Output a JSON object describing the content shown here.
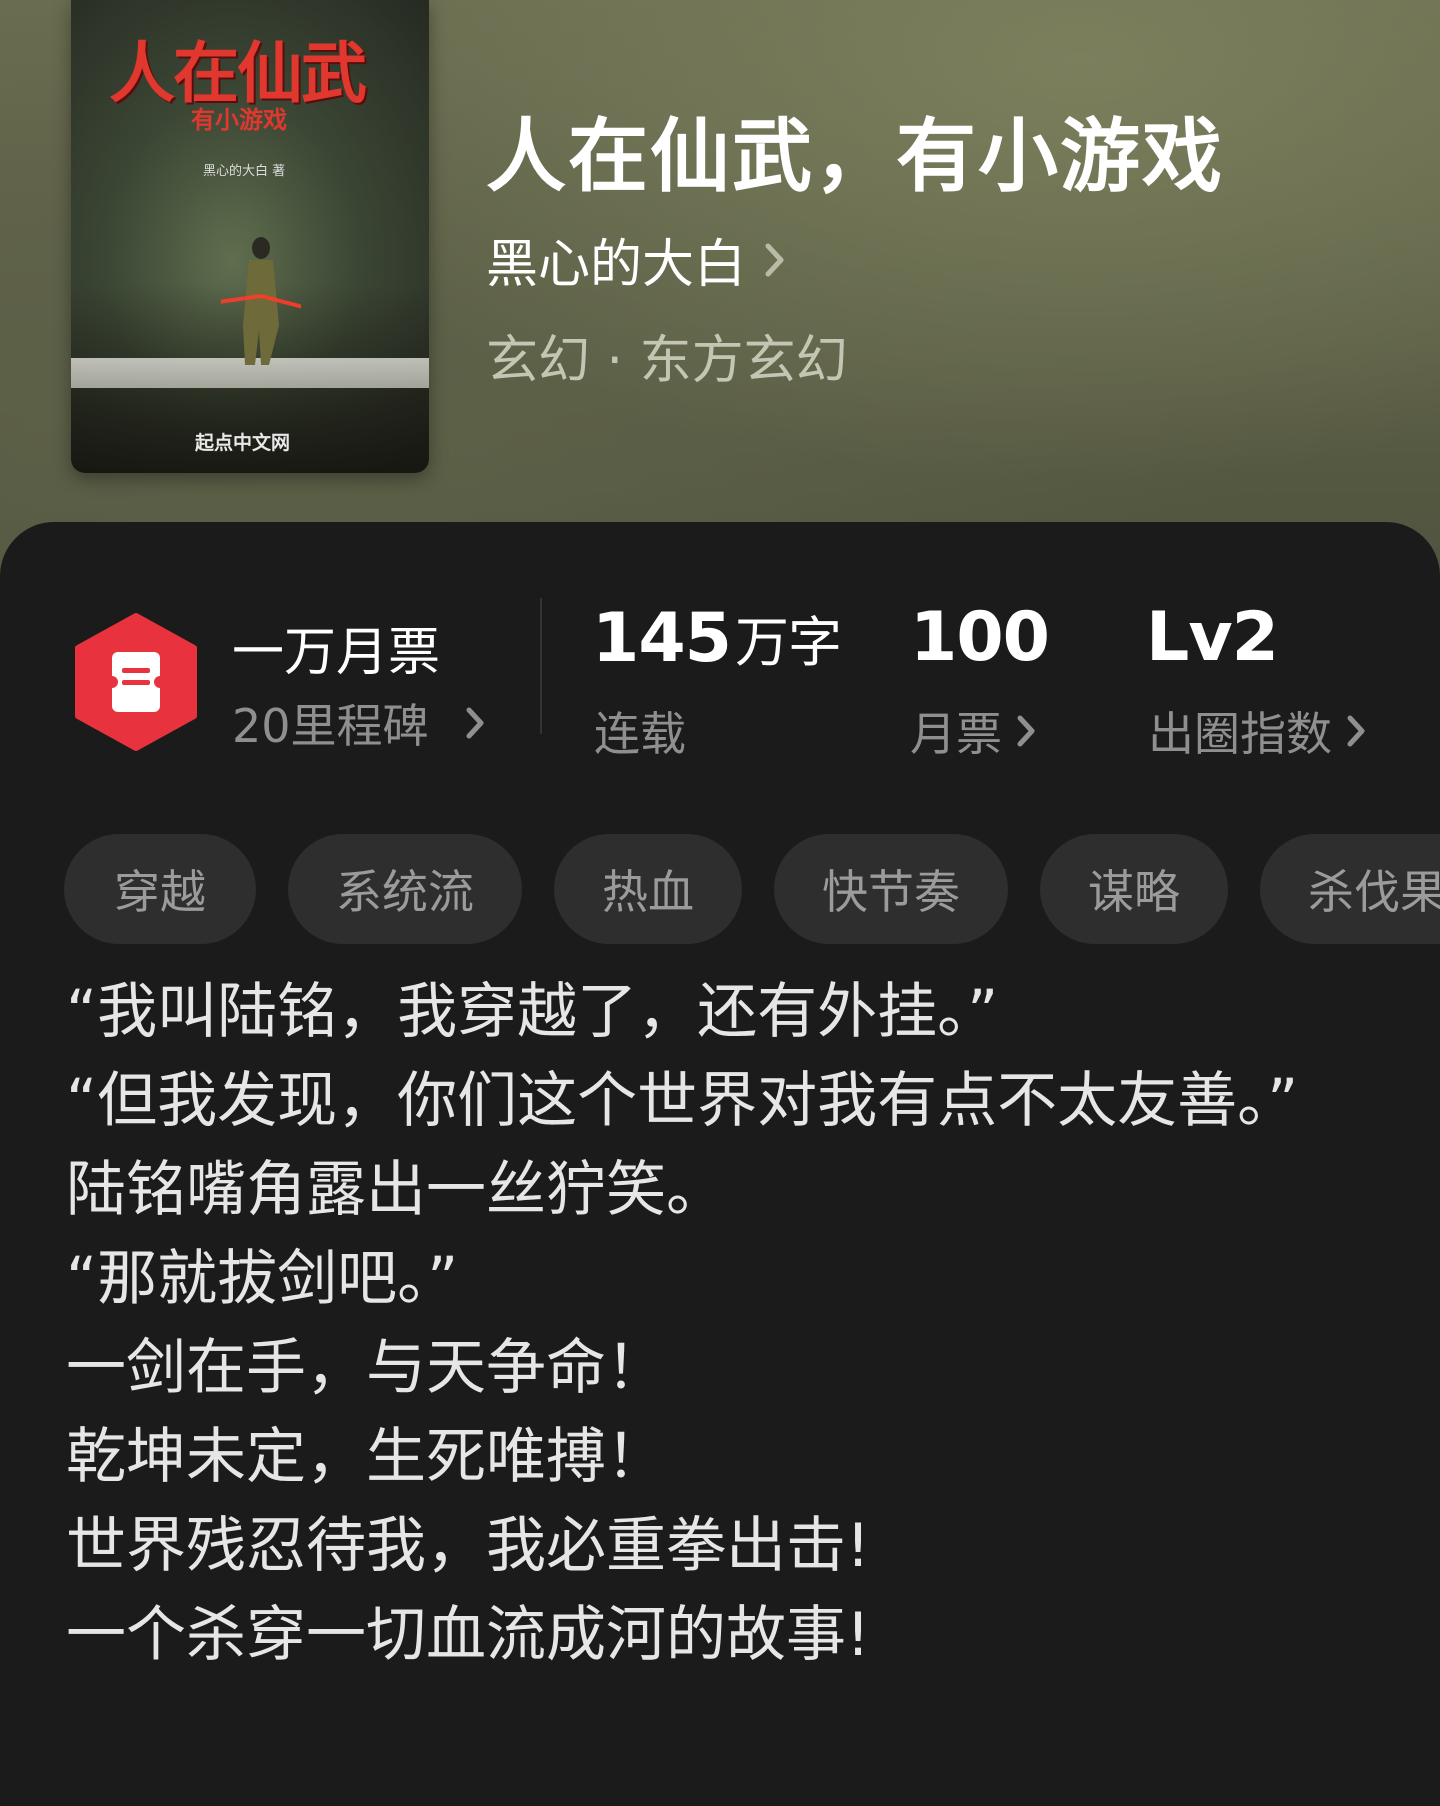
{
  "cover": {
    "title": "人在仙武",
    "subtitle": "有小游戏",
    "author": "黑心的大白 著",
    "publisher": "起点中文网"
  },
  "book": {
    "title": "人在仙武，有小游戏",
    "author": "黑心的大白",
    "genre": "玄幻 · 东方玄幻"
  },
  "stats": {
    "milestone_title": "一万月票",
    "milestone_sub": "20里程碑",
    "words_value": "145",
    "words_unit": "万字",
    "words_label": "连载",
    "tickets_value": "100",
    "tickets_label": "月票",
    "index_value": "Lv2",
    "index_label": "出圈指数"
  },
  "tags": [
    "穿越",
    "系统流",
    "热血",
    "快节奏",
    "谋略",
    "杀伐果"
  ],
  "description": [
    "“我叫陆铭，我穿越了，还有外挂。”",
    "“但我发现，你们这个世界对我有点不太友善。”",
    "陆铭嘴角露出一丝狞笑。",
    "“那就拔剑吧。”",
    "一剑在手，与天争命！",
    "乾坤未定，生死唯搏！",
    "世界残忍待我，我必重拳出击!",
    "一个杀穿一切血流成河的故事!"
  ],
  "colors": {
    "accent_red": "#e8333f",
    "panel_bg": "#1b1b1b",
    "tag_bg": "#2e2e2e"
  },
  "icons": {
    "badge": "ticket-hexagon-icon",
    "chevron": "chevron-right-icon"
  }
}
